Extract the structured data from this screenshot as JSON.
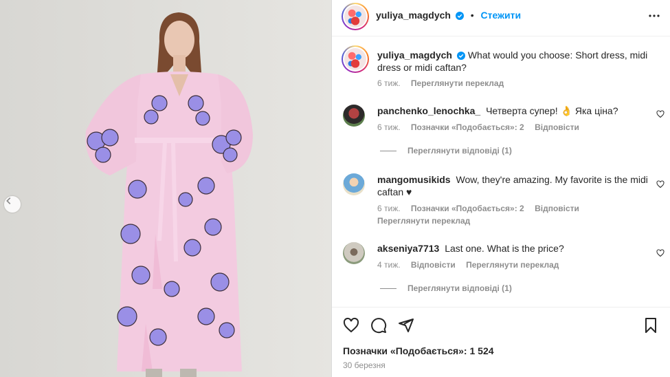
{
  "post": {
    "username": "yuliya_magdych",
    "follow_label": "Стежити",
    "caption_text": "What would you choose: Short dress, midi dress or midi caftan?",
    "caption_time": "6 тиж.",
    "caption_translate": "Переглянути переклад"
  },
  "comments": [
    {
      "username": "panchenko_lenochka_",
      "text": "Четверта супер! 👌 Яка ціна?",
      "time": "6 тиж.",
      "likes": "Позначки «Подобається»: 2",
      "reply": "Відповісти",
      "view_replies": "Переглянути відповіді (1)"
    },
    {
      "username": "mangomusikids",
      "text": "Wow, they're amazing. My favorite is the midi caftan ♥",
      "time": "6 тиж.",
      "likes": "Позначки «Подобається»: 2",
      "reply": "Відповісти",
      "translate": "Переглянути переклад"
    },
    {
      "username": "akseniya7713",
      "text": "Last one. What is the price?",
      "time": "4 тиж.",
      "reply": "Відповісти",
      "translate": "Переглянути переклад",
      "view_replies": "Переглянути відповіді (1)"
    }
  ],
  "footer": {
    "likes": "Позначки «Подобається»: 1 524",
    "date": "30 березня"
  },
  "colors": {
    "accent": "#0095f6",
    "muted": "#8e8e8e",
    "text": "#262626",
    "heart": "#b0151b"
  },
  "icons": [
    "more-icon",
    "verified-icon",
    "heart-icon",
    "comment-icon",
    "share-icon",
    "bookmark-icon",
    "chevron-left-icon"
  ]
}
